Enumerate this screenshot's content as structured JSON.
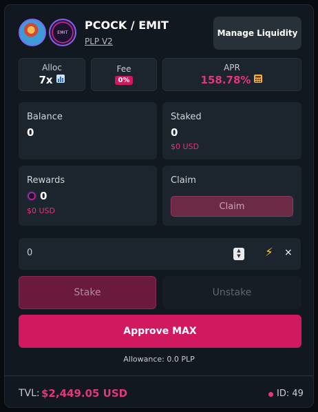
{
  "header": {
    "token1_icon": "pcock-token-icon",
    "token2_icon": "emit-token-icon",
    "token2_text": "EMIT",
    "pair": "PCOCK / EMIT",
    "version": "PLP V2",
    "manage_label": "Manage Liquidity"
  },
  "stats": {
    "alloc_label": "Alloc",
    "alloc_value": "7x",
    "fee_label": "Fee",
    "fee_value": "0%",
    "apr_label": "APR",
    "apr_value": "158.78%"
  },
  "balance": {
    "label": "Balance",
    "value": "0"
  },
  "staked": {
    "label": "Staked",
    "value": "0",
    "usd": "$0 USD"
  },
  "rewards": {
    "label": "Rewards",
    "value": "0",
    "usd": "$0 USD"
  },
  "claim": {
    "label": "Claim",
    "button": "Claim"
  },
  "amount": {
    "value": "0"
  },
  "actions": {
    "stake": "Stake",
    "unstake": "Unstake",
    "approve": "Approve MAX"
  },
  "allowance": "Allowance: 0.0 PLP",
  "footer": {
    "tvl_label": "TVL:",
    "tvl_value": "$2,449.05 USD",
    "id": "ID: 49"
  },
  "colors": {
    "accent": "#d1195f",
    "pink_text": "#e0387a",
    "card": "#111820",
    "panel": "#1c242e"
  }
}
